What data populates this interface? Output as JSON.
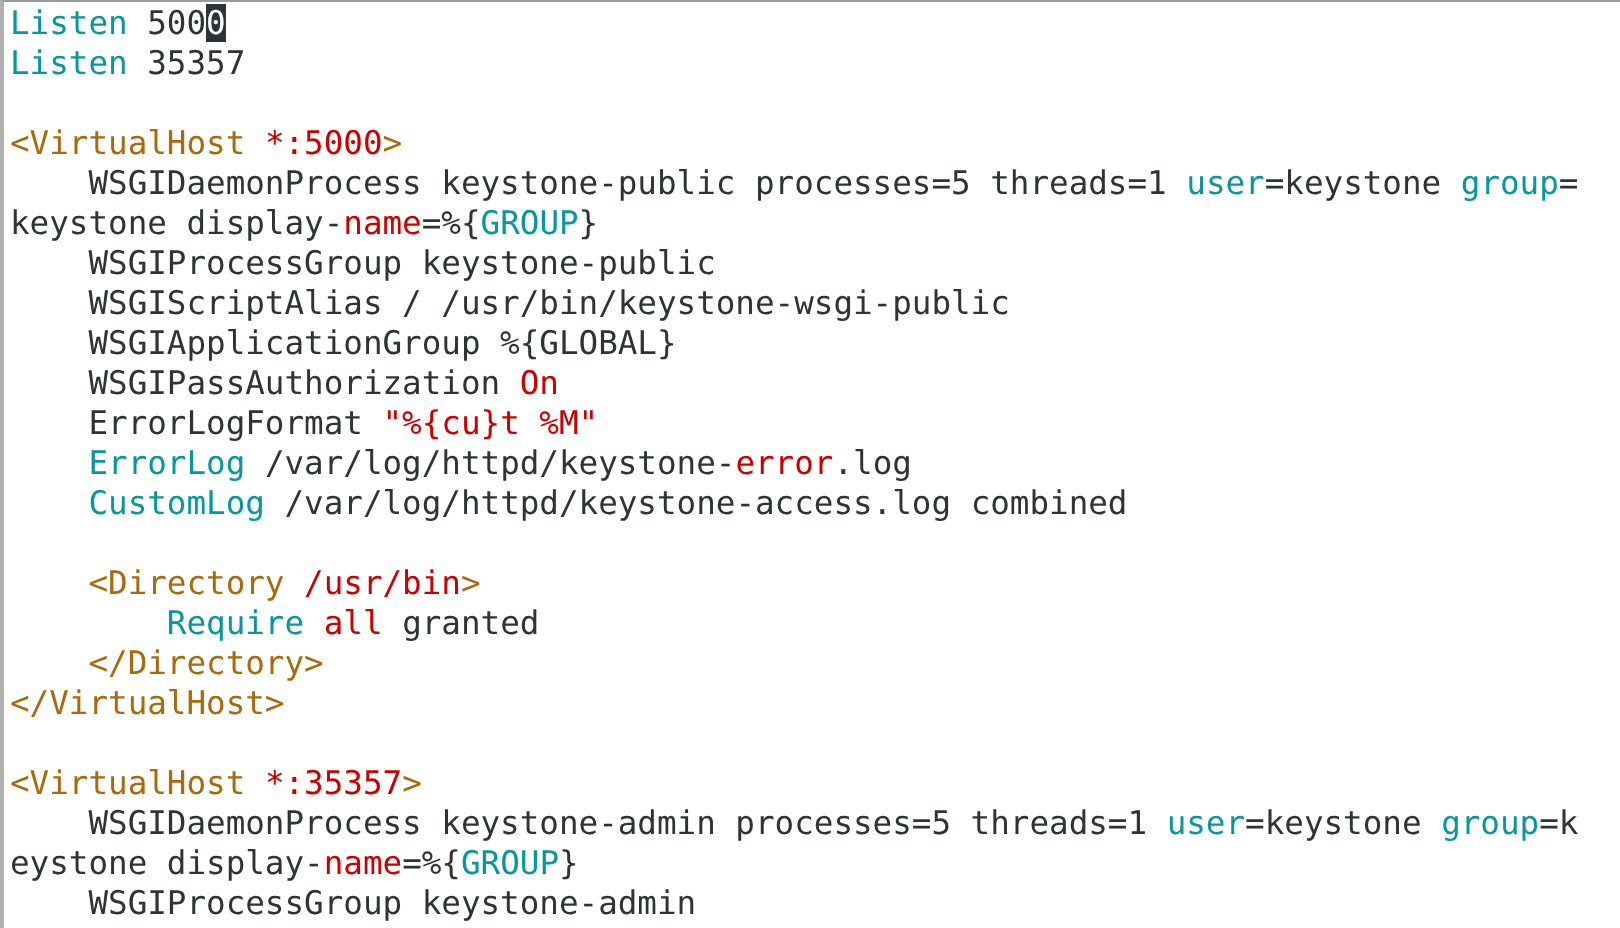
{
  "editor": {
    "lines": [
      {
        "kind": "code",
        "segments": [
          {
            "kind": "keyword",
            "text": "Listen"
          },
          {
            "kind": "plain",
            "text": " 500"
          },
          {
            "kind": "cursor",
            "text": "0"
          }
        ]
      },
      {
        "kind": "code",
        "segments": [
          {
            "kind": "keyword",
            "text": "Listen"
          },
          {
            "kind": "plain",
            "text": " 35357"
          }
        ]
      },
      {
        "kind": "blank"
      },
      {
        "kind": "code",
        "segments": [
          {
            "kind": "tag",
            "text": "<VirtualHost"
          },
          {
            "kind": "constant",
            "text": " *:5000"
          },
          {
            "kind": "tag",
            "text": ">"
          }
        ]
      },
      {
        "kind": "code",
        "segments": [
          {
            "kind": "plain",
            "text": "    WSGIDaemonProcess keystone-public processes=5 threads=1 "
          },
          {
            "kind": "keyword",
            "text": "user"
          },
          {
            "kind": "plain",
            "text": "=keystone "
          },
          {
            "kind": "keyword",
            "text": "group"
          },
          {
            "kind": "plain",
            "text": "="
          }
        ]
      },
      {
        "kind": "code",
        "segments": [
          {
            "kind": "plain",
            "text": "keystone display-"
          },
          {
            "kind": "constant",
            "text": "name"
          },
          {
            "kind": "plain",
            "text": "=%{"
          },
          {
            "kind": "keyword",
            "text": "GROUP"
          },
          {
            "kind": "plain",
            "text": "}"
          }
        ]
      },
      {
        "kind": "code",
        "segments": [
          {
            "kind": "plain",
            "text": "    WSGIProcessGroup keystone-public"
          }
        ]
      },
      {
        "kind": "code",
        "segments": [
          {
            "kind": "plain",
            "text": "    WSGIScriptAlias / /usr/bin/keystone-wsgi-public"
          }
        ]
      },
      {
        "kind": "code",
        "segments": [
          {
            "kind": "plain",
            "text": "    WSGIApplicationGroup %{GLOBAL}"
          }
        ]
      },
      {
        "kind": "code",
        "segments": [
          {
            "kind": "plain",
            "text": "    WSGIPassAuthorization "
          },
          {
            "kind": "constant",
            "text": "On"
          }
        ]
      },
      {
        "kind": "code",
        "segments": [
          {
            "kind": "plain",
            "text": "    ErrorLogFormat "
          },
          {
            "kind": "constant",
            "text": "\"%{cu}t %M\""
          }
        ]
      },
      {
        "kind": "code",
        "segments": [
          {
            "kind": "keyword",
            "text": "    ErrorLog"
          },
          {
            "kind": "plain",
            "text": " /var/log/httpd/keystone-"
          },
          {
            "kind": "constant",
            "text": "error"
          },
          {
            "kind": "plain",
            "text": ".log"
          }
        ]
      },
      {
        "kind": "code",
        "segments": [
          {
            "kind": "keyword",
            "text": "    CustomLog"
          },
          {
            "kind": "plain",
            "text": " /var/log/httpd/keystone-access.log combined"
          }
        ]
      },
      {
        "kind": "blank"
      },
      {
        "kind": "code",
        "segments": [
          {
            "kind": "tag",
            "text": "    <Directory"
          },
          {
            "kind": "constant",
            "text": " /usr/bin"
          },
          {
            "kind": "tag",
            "text": ">"
          }
        ]
      },
      {
        "kind": "code",
        "segments": [
          {
            "kind": "keyword",
            "text": "        Require "
          },
          {
            "kind": "constant",
            "text": "all"
          },
          {
            "kind": "plain",
            "text": " granted"
          }
        ]
      },
      {
        "kind": "code",
        "segments": [
          {
            "kind": "tag",
            "text": "    </Directory>"
          }
        ]
      },
      {
        "kind": "code",
        "segments": [
          {
            "kind": "tag",
            "text": "</VirtualHost>"
          }
        ]
      },
      {
        "kind": "blank"
      },
      {
        "kind": "code",
        "segments": [
          {
            "kind": "tag",
            "text": "<VirtualHost"
          },
          {
            "kind": "constant",
            "text": " *:35357"
          },
          {
            "kind": "tag",
            "text": ">"
          }
        ]
      },
      {
        "kind": "code",
        "segments": [
          {
            "kind": "plain",
            "text": "    WSGIDaemonProcess keystone-admin processes=5 threads=1 "
          },
          {
            "kind": "keyword",
            "text": "user"
          },
          {
            "kind": "plain",
            "text": "=keystone "
          },
          {
            "kind": "keyword",
            "text": "group"
          },
          {
            "kind": "plain",
            "text": "=k"
          }
        ]
      },
      {
        "kind": "code",
        "segments": [
          {
            "kind": "plain",
            "text": "eystone display-"
          },
          {
            "kind": "constant",
            "text": "name"
          },
          {
            "kind": "plain",
            "text": "=%{"
          },
          {
            "kind": "keyword",
            "text": "GROUP"
          },
          {
            "kind": "plain",
            "text": "}"
          }
        ]
      },
      {
        "kind": "code",
        "segments": [
          {
            "kind": "plain",
            "text": "    WSGIProcessGroup keystone-admin"
          }
        ]
      }
    ]
  }
}
